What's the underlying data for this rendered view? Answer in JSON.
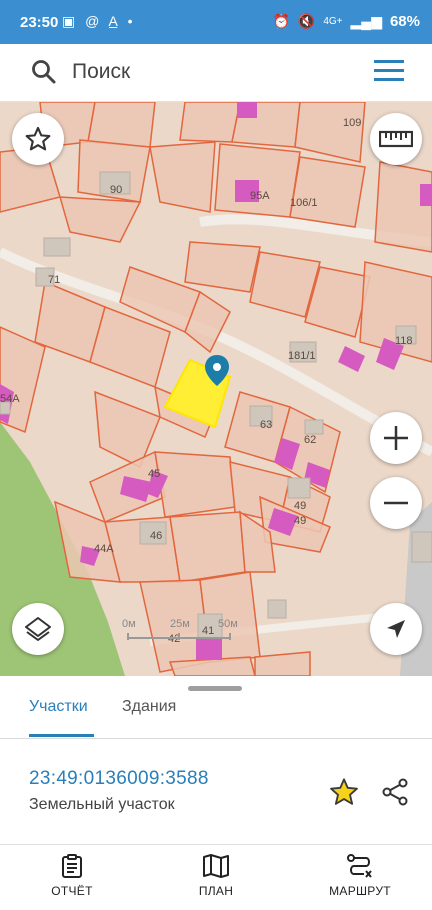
{
  "status_bar": {
    "time": "23:50",
    "left_icons": "▣ @ A̲ •",
    "network": "4G+",
    "battery": "68%"
  },
  "search": {
    "placeholder": "Поиск"
  },
  "map": {
    "labels": [
      "109",
      "90",
      "95А",
      "106/1",
      "71",
      "181/1",
      "118",
      "54А",
      "63",
      "62",
      "45",
      "49",
      "49",
      "46",
      "44А",
      "42",
      "41"
    ],
    "scale": {
      "zero": "0м",
      "mid": "25м",
      "end": "50м"
    }
  },
  "sheet": {
    "tabs": [
      "Участки",
      "Здания"
    ],
    "active_tab": "Участки",
    "cadastral_number": "23:49:0136009:3588",
    "object_type": "Земельный участок"
  },
  "bottom_nav": {
    "report": "ОТЧЁТ",
    "plan": "ПЛАН",
    "route": "МАРШРУТ"
  },
  "colors": {
    "accent": "#2a7fb8",
    "status_bar": "#3b8fd0",
    "parcel_fill": "#ecc7b4",
    "parcel_stroke": "#e2673e",
    "building": "#d65bc0",
    "selected": "#ffee33",
    "forest": "#9ec576"
  }
}
